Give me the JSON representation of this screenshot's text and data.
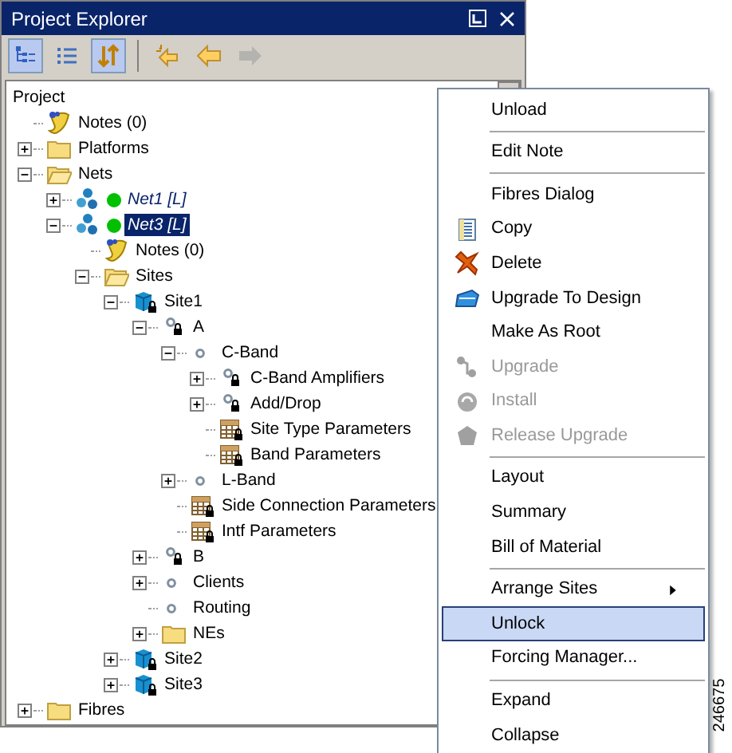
{
  "window": {
    "title": "Project Explorer"
  },
  "toolbar": [
    {
      "kind": "tree-view",
      "pressed": true,
      "disabled": false
    },
    {
      "kind": "list-view",
      "pressed": false,
      "disabled": false
    },
    {
      "kind": "sort",
      "pressed": true,
      "disabled": false
    },
    {
      "kind": "back-star",
      "pressed": false,
      "disabled": false
    },
    {
      "kind": "back",
      "pressed": false,
      "disabled": false
    },
    {
      "kind": "forward",
      "pressed": false,
      "disabled": true
    }
  ],
  "tree": [
    {
      "label": "Project",
      "selected": false,
      "children": [
        {
          "label": "Notes (0)",
          "kind": "notes",
          "selected": false
        },
        {
          "label": "Platforms",
          "kind": "folder",
          "expanded": false,
          "selected": false
        },
        {
          "label": "Nets",
          "kind": "folder",
          "expanded": true,
          "selected": false,
          "children": [
            {
              "label": "Net1 [L]",
              "kind": "network",
              "color": "#00c000",
              "expanded": false,
              "selected": false
            },
            {
              "label": "Net3 [L]",
              "kind": "network",
              "color": "#00c000",
              "expanded": true,
              "selected": true,
              "children": [
                {
                  "label": "Notes (0)",
                  "kind": "notes",
                  "selected": false
                },
                {
                  "label": "Sites",
                  "kind": "folder",
                  "expanded": true,
                  "selected": false,
                  "children": [
                    {
                      "label": "Site1",
                      "kind": "site",
                      "locked": true,
                      "expanded": true,
                      "selected": false,
                      "children": [
                        {
                          "label": "A",
                          "kind": "node",
                          "locked": true,
                          "expanded": true,
                          "selected": false,
                          "children": [
                            {
                              "label": "C-Band",
                              "kind": "node",
                              "locked": false,
                              "expanded": true,
                              "selected": false,
                              "children": [
                                {
                                  "label": "C-Band Amplifiers",
                                  "kind": "node",
                                  "locked": true,
                                  "expanded": false,
                                  "selected": false
                                },
                                {
                                  "label": "Add/Drop",
                                  "kind": "node",
                                  "locked": true,
                                  "expanded": false,
                                  "selected": false
                                },
                                {
                                  "label": "Site Type Parameters",
                                  "kind": "table",
                                  "locked": true,
                                  "selected": false
                                },
                                {
                                  "label": "Band Parameters",
                                  "kind": "table",
                                  "locked": true,
                                  "selected": false
                                }
                              ]
                            },
                            {
                              "label": "L-Band",
                              "kind": "node",
                              "locked": false,
                              "expanded": false,
                              "selected": false
                            },
                            {
                              "label": "Side Connection Parameters",
                              "kind": "table",
                              "locked": true,
                              "selected": false
                            },
                            {
                              "label": "Intf Parameters",
                              "kind": "table",
                              "locked": true,
                              "selected": false
                            }
                          ]
                        },
                        {
                          "label": "B",
                          "kind": "node",
                          "locked": true,
                          "expanded": false,
                          "selected": false
                        },
                        {
                          "label": "Clients",
                          "kind": "node",
                          "locked": false,
                          "expanded": false,
                          "selected": false
                        },
                        {
                          "label": "Routing",
                          "kind": "node",
                          "locked": false,
                          "selected": false
                        },
                        {
                          "label": "NEs",
                          "kind": "folder",
                          "expanded": false,
                          "selected": false
                        }
                      ]
                    },
                    {
                      "label": "Site2",
                      "kind": "site",
                      "locked": true,
                      "expanded": false,
                      "selected": false
                    },
                    {
                      "label": "Site3",
                      "kind": "site",
                      "locked": true,
                      "expanded": false,
                      "selected": false
                    }
                  ]
                }
              ]
            }
          ]
        },
        {
          "label": "Fibres",
          "kind": "folder",
          "expanded": false,
          "selected": false
        }
      ]
    }
  ],
  "context_menu": {
    "groups": [
      [
        {
          "label": "Unload",
          "selected": false,
          "disabled": false
        }
      ],
      [
        {
          "label": "Edit Note",
          "selected": false,
          "disabled": false
        }
      ],
      [
        {
          "label": "Fibres Dialog",
          "selected": false,
          "disabled": false
        },
        {
          "label": "Copy",
          "kind": "copy",
          "selected": false,
          "disabled": false
        },
        {
          "label": "Delete",
          "kind": "delete",
          "selected": false,
          "disabled": false
        },
        {
          "label": "Upgrade To Design",
          "kind": "design",
          "selected": false,
          "disabled": false
        },
        {
          "label": "Make As Root",
          "selected": false,
          "disabled": false
        },
        {
          "label": "Upgrade",
          "kind": "upgrade",
          "selected": false,
          "disabled": true
        },
        {
          "label": "Install",
          "kind": "install",
          "selected": false,
          "disabled": true
        },
        {
          "label": "Release Upgrade",
          "kind": "release",
          "selected": false,
          "disabled": true
        }
      ],
      [
        {
          "label": "Layout",
          "selected": false,
          "disabled": false
        },
        {
          "label": "Summary",
          "selected": false,
          "disabled": false
        },
        {
          "label": "Bill of Material",
          "selected": false,
          "disabled": false
        }
      ],
      [
        {
          "label": "Arrange Sites",
          "submenu": true,
          "selected": false,
          "disabled": false
        },
        {
          "label": "Unlock",
          "selected": true,
          "disabled": false
        },
        {
          "label": "Forcing Manager...",
          "selected": false,
          "disabled": false
        }
      ],
      [
        {
          "label": "Expand",
          "selected": false,
          "disabled": false
        },
        {
          "label": "Collapse",
          "selected": false,
          "disabled": false
        }
      ]
    ]
  },
  "figure_number": "246675"
}
